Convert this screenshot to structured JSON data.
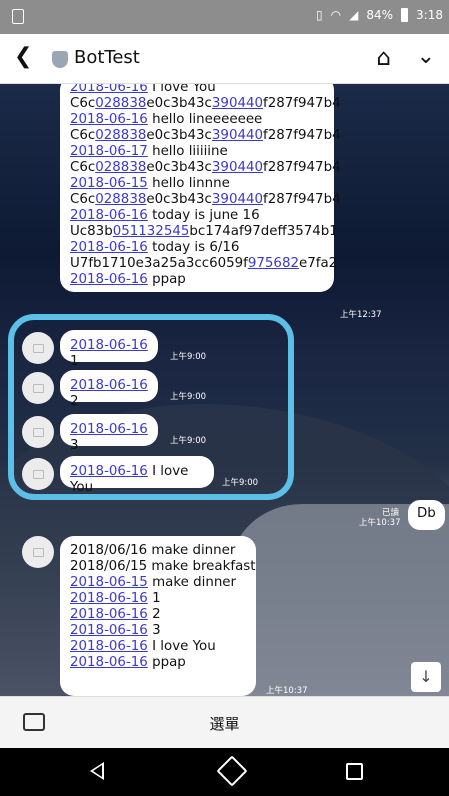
{
  "status": {
    "battery": "84%",
    "time": "3:18"
  },
  "header": {
    "title": "BotTest"
  },
  "top_bubble": {
    "lines": [
      {
        "link": "2018-06-16",
        "text": " I love You"
      },
      {
        "pre": "C6c",
        "link": "028838",
        "mid": "e0c3b43c",
        "link2": "390440",
        "post": "f287f947b4"
      },
      {
        "link": "2018-06-16",
        "text": " hello lineeeeeee"
      },
      {
        "pre": "C6c",
        "link": "028838",
        "mid": "e0c3b43c",
        "link2": "390440",
        "post": "f287f947b4"
      },
      {
        "link": "2018-06-17",
        "text": " hello liiiiine"
      },
      {
        "pre": "C6c",
        "link": "028838",
        "mid": "e0c3b43c",
        "link2": "390440",
        "post": "f287f947b4"
      },
      {
        "link": "2018-06-15",
        "text": " hello linnne"
      },
      {
        "pre": "C6c",
        "link": "028838",
        "mid": "e0c3b43c",
        "link2": "390440",
        "post": "f287f947b4"
      },
      {
        "link": "2018-06-16",
        "text": " today is june 16"
      },
      {
        "pre": "Uc83b",
        "link": "051132545",
        "post": "bc174af97deff3574b1"
      },
      {
        "link": "2018-06-16",
        "text": " today is 6/16"
      },
      {
        "pre": "U7fb1710e3a25a3cc6059f",
        "link": "975682",
        "post": "e7fa2"
      },
      {
        "link": "2018-06-16",
        "text": " ppap"
      }
    ],
    "time": "上午12:37"
  },
  "small_msgs": [
    {
      "date": "2018-06-16",
      "text": " 1",
      "time": "上午9:00"
    },
    {
      "date": "2018-06-16",
      "text": " 2",
      "time": "上午9:00"
    },
    {
      "date": "2018-06-16",
      "text": " 3",
      "time": "上午9:00"
    },
    {
      "date": "2018-06-16",
      "text": " I love You",
      "time": "上午9:00"
    }
  ],
  "my_msg": {
    "text": "Db",
    "read": "已讀",
    "time": "上午10:37"
  },
  "bottom_bubble": {
    "lines": [
      {
        "text": "2018/06/16 make dinner"
      },
      {
        "text": "2018/06/15 make breakfast"
      },
      {
        "link": "2018-06-15",
        "text": " make dinner"
      },
      {
        "link": "2018-06-16",
        "text": " 1"
      },
      {
        "link": "2018-06-16",
        "text": " 2"
      },
      {
        "link": "2018-06-16",
        "text": " 3"
      },
      {
        "link": "2018-06-16",
        "text": " I love You"
      },
      {
        "link": "2018-06-16",
        "text": " ppap"
      }
    ],
    "time": "上午10:37"
  },
  "menu": {
    "label": "選單"
  },
  "icons": {
    "back": "chevron-left-icon",
    "home": "home-icon",
    "expand": "chevron-down-icon",
    "scroll": "arrow-down-icon"
  }
}
